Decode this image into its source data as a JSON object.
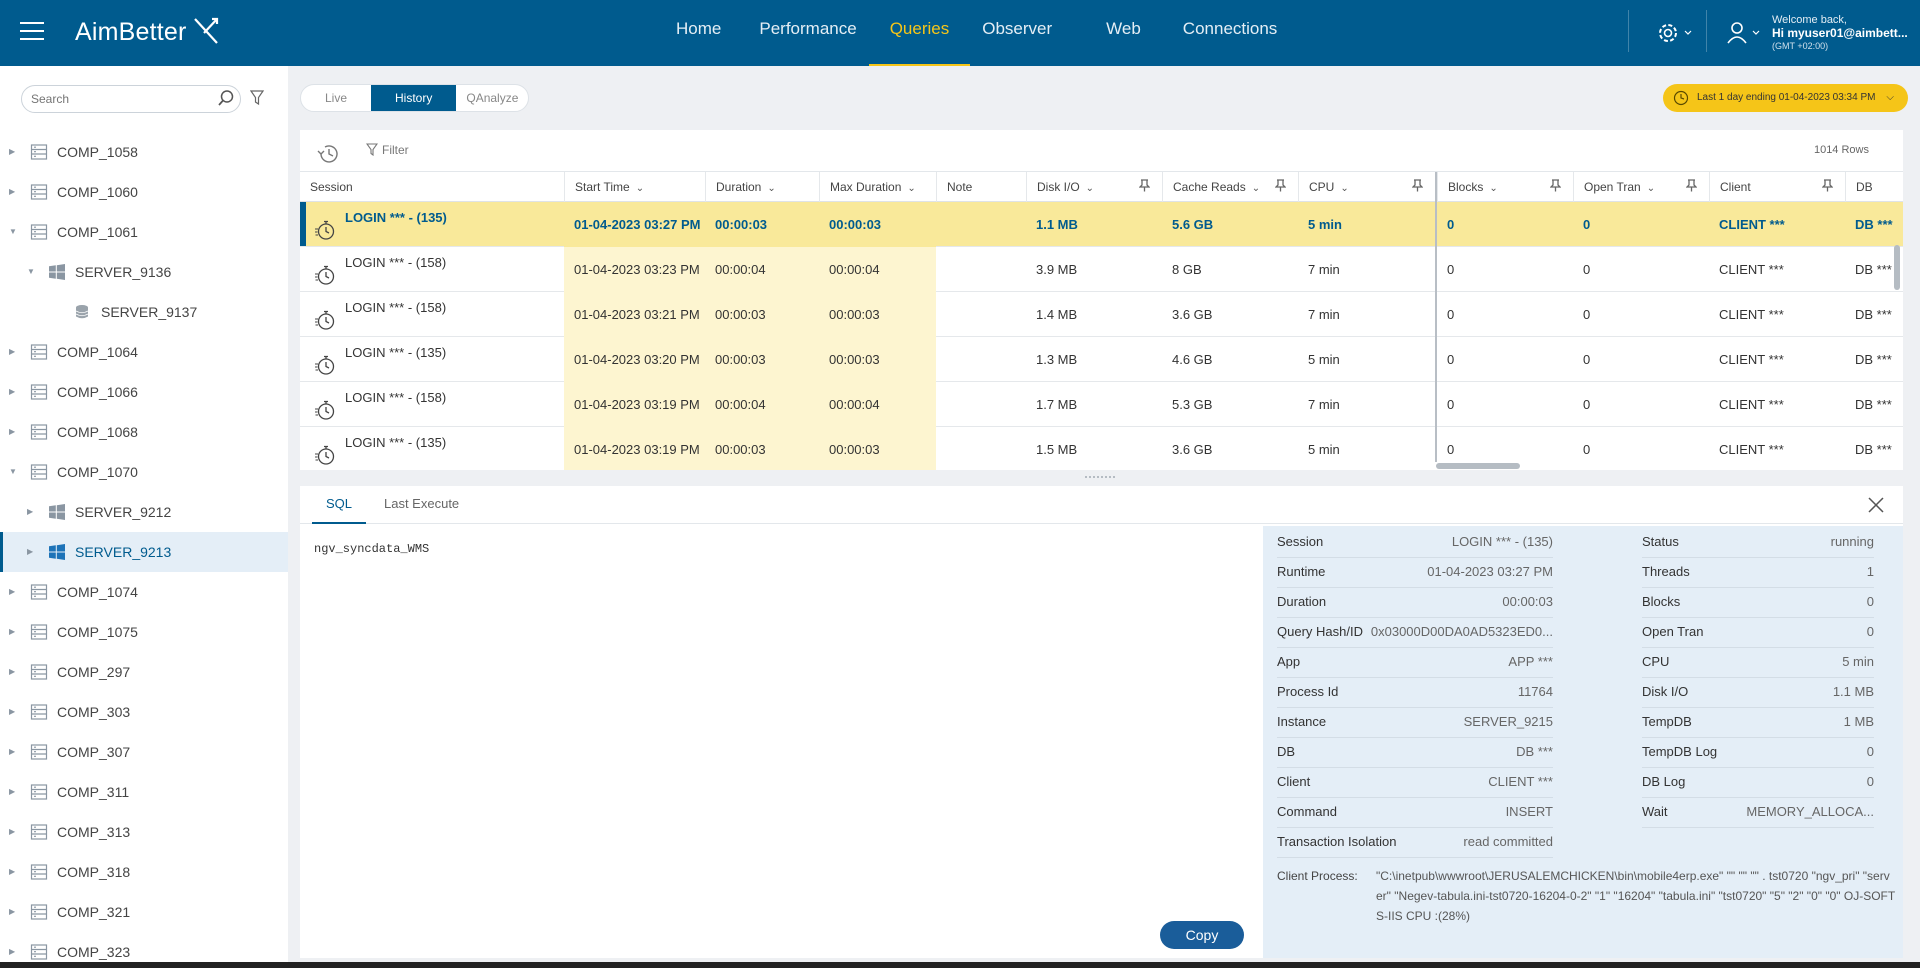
{
  "app": {
    "brand": "AimBetter"
  },
  "nav": {
    "items": [
      {
        "label": "Home"
      },
      {
        "label": "Performance"
      },
      {
        "label": "Queries"
      },
      {
        "label": "Observer"
      },
      {
        "label": "Web"
      },
      {
        "label": "Connections"
      }
    ],
    "active": "Queries"
  },
  "user": {
    "welcome": "Welcome back,",
    "name": "Hi myuser01@aimbett...",
    "timezone": "(GMT +02:00)"
  },
  "sidebar": {
    "search_placeholder": "Search",
    "items": [
      {
        "label": "COMP_1058",
        "level": 0,
        "icon": "server-rack-icon",
        "expanded": false
      },
      {
        "label": "COMP_1060",
        "level": 0,
        "icon": "server-rack-icon",
        "expanded": false
      },
      {
        "label": "COMP_1061",
        "level": 0,
        "icon": "server-rack-icon",
        "expanded": true
      },
      {
        "label": "SERVER_9136",
        "level": 1,
        "icon": "windows-icon",
        "expanded": true
      },
      {
        "label": "SERVER_9137",
        "level": 2,
        "icon": "database-icon",
        "expanded": null
      },
      {
        "label": "COMP_1064",
        "level": 0,
        "icon": "server-rack-icon",
        "expanded": false
      },
      {
        "label": "COMP_1066",
        "level": 0,
        "icon": "server-rack-icon",
        "expanded": false
      },
      {
        "label": "COMP_1068",
        "level": 0,
        "icon": "server-rack-icon",
        "expanded": false
      },
      {
        "label": "COMP_1070",
        "level": 0,
        "icon": "server-rack-icon",
        "expanded": true
      },
      {
        "label": "SERVER_9212",
        "level": 1,
        "icon": "windows-icon",
        "expanded": false
      },
      {
        "label": "SERVER_9213",
        "level": 1,
        "icon": "windows-icon",
        "expanded": false,
        "selected": true
      },
      {
        "label": "COMP_1074",
        "level": 0,
        "icon": "server-rack-icon",
        "expanded": false
      },
      {
        "label": "COMP_1075",
        "level": 0,
        "icon": "server-rack-icon",
        "expanded": false
      },
      {
        "label": "COMP_297",
        "level": 0,
        "icon": "server-rack-icon",
        "expanded": false
      },
      {
        "label": "COMP_303",
        "level": 0,
        "icon": "server-rack-icon",
        "expanded": false
      },
      {
        "label": "COMP_307",
        "level": 0,
        "icon": "server-rack-icon",
        "expanded": false
      },
      {
        "label": "COMP_311",
        "level": 0,
        "icon": "server-rack-icon",
        "expanded": false
      },
      {
        "label": "COMP_313",
        "level": 0,
        "icon": "server-rack-icon",
        "expanded": false
      },
      {
        "label": "COMP_318",
        "level": 0,
        "icon": "server-rack-icon",
        "expanded": false
      },
      {
        "label": "COMP_321",
        "level": 0,
        "icon": "server-rack-icon",
        "expanded": false
      },
      {
        "label": "COMP_323",
        "level": 0,
        "icon": "server-rack-icon",
        "expanded": false
      }
    ]
  },
  "view_toggle": {
    "live": "Live",
    "history": "History",
    "qanalyze": "QAnalyze"
  },
  "time_range": {
    "label": "Last 1 day ending  01-04-2023 03:34 PM"
  },
  "grid": {
    "filter_label": "Filter",
    "rows_count": "1014 Rows",
    "columns": [
      "Session",
      "Start Time",
      "Duration",
      "Max Duration",
      "Note",
      "Disk I/O",
      "Cache Reads",
      "CPU",
      "Blocks",
      "Open Tran",
      "Client",
      "DB"
    ],
    "rows": [
      {
        "session": "LOGIN *** - (135)",
        "start": "01-04-2023 03:27 PM",
        "duration": "00:00:03",
        "max_duration": "00:00:03",
        "note": "",
        "disk_io": "1.1 MB",
        "cache_reads": "5.6 GB",
        "cpu": "5 min",
        "blocks": "0",
        "open_tran": "0",
        "client": "CLIENT ***",
        "db": "DB ***"
      },
      {
        "session": "LOGIN *** - (158)",
        "start": "01-04-2023 03:23 PM",
        "duration": "00:00:04",
        "max_duration": "00:00:04",
        "note": "",
        "disk_io": "3.9 MB",
        "cache_reads": "8 GB",
        "cpu": "7 min",
        "blocks": "0",
        "open_tran": "0",
        "client": "CLIENT ***",
        "db": "DB ***"
      },
      {
        "session": "LOGIN *** - (158)",
        "start": "01-04-2023 03:21 PM",
        "duration": "00:00:03",
        "max_duration": "00:00:03",
        "note": "",
        "disk_io": "1.4 MB",
        "cache_reads": "3.6 GB",
        "cpu": "7 min",
        "blocks": "0",
        "open_tran": "0",
        "client": "CLIENT ***",
        "db": "DB ***"
      },
      {
        "session": "LOGIN *** - (135)",
        "start": "01-04-2023 03:20 PM",
        "duration": "00:00:03",
        "max_duration": "00:00:03",
        "note": "",
        "disk_io": "1.3 MB",
        "cache_reads": "4.6 GB",
        "cpu": "5 min",
        "blocks": "0",
        "open_tran": "0",
        "client": "CLIENT ***",
        "db": "DB ***"
      },
      {
        "session": "LOGIN *** - (158)",
        "start": "01-04-2023 03:19 PM",
        "duration": "00:00:04",
        "max_duration": "00:00:04",
        "note": "",
        "disk_io": "1.7 MB",
        "cache_reads": "5.3 GB",
        "cpu": "7 min",
        "blocks": "0",
        "open_tran": "0",
        "client": "CLIENT ***",
        "db": "DB ***"
      },
      {
        "session": "LOGIN *** - (135)",
        "start": "01-04-2023 03:19 PM",
        "duration": "00:00:03",
        "max_duration": "00:00:03",
        "note": "",
        "disk_io": "1.5 MB",
        "cache_reads": "3.6 GB",
        "cpu": "5 min",
        "blocks": "0",
        "open_tran": "0",
        "client": "CLIENT ***",
        "db": "DB ***"
      }
    ]
  },
  "detail": {
    "tabs": [
      "SQL",
      "Last Execute"
    ],
    "sql_text": "ngv_syncdata_WMS",
    "copy_label": "Copy",
    "left_fields": [
      {
        "k": "Session",
        "v": "LOGIN *** - (135)"
      },
      {
        "k": "Runtime",
        "v": "01-04-2023 03:27 PM"
      },
      {
        "k": "Duration",
        "v": "00:00:03"
      },
      {
        "k": "Query Hash/ID",
        "v": "0x03000D00DA0AD5323ED0..."
      },
      {
        "k": "App",
        "v": "APP ***"
      },
      {
        "k": "Process Id",
        "v": "11764"
      },
      {
        "k": "Instance",
        "v": "SERVER_9215"
      },
      {
        "k": "DB",
        "v": "DB ***"
      },
      {
        "k": "Client",
        "v": "CLIENT ***"
      },
      {
        "k": "Command",
        "v": "INSERT"
      },
      {
        "k": "Transaction Isolation",
        "v": "read committed"
      }
    ],
    "right_fields": [
      {
        "k": "Status",
        "v": "running"
      },
      {
        "k": "Threads",
        "v": "1"
      },
      {
        "k": "Blocks",
        "v": "0"
      },
      {
        "k": "Open Tran",
        "v": "0"
      },
      {
        "k": "CPU",
        "v": "5 min"
      },
      {
        "k": "Disk I/O",
        "v": "1.1 MB"
      },
      {
        "k": "TempDB",
        "v": "1 MB"
      },
      {
        "k": "TempDB Log",
        "v": "0"
      },
      {
        "k": "DB Log",
        "v": "0"
      },
      {
        "k": "Wait",
        "v": "MEMORY_ALLOCA..."
      }
    ],
    "client_process_label": "Client Process:",
    "client_process_value": "\"C:\\inetpub\\wwwroot\\JERUSALEMCHICKEN\\bin\\mobile4erp.exe\" \"\" \"\" \"\" . tst0720 \"ngv_pri\" \"server\" \"Negev-tabula.ini-tst0720-16204-0-2\" \"1\" \"16204\" \"tabula.ini\" \"tst0720\" \"5\" \"2\" \"0\" \"0\" OJ-SOFTS-IIS CPU :(28%)"
  },
  "colors": {
    "primary": "#005b8e",
    "accent": "#f5c518",
    "selected_row": "#f9e99a",
    "highlight_col": "#fdf5d0"
  }
}
